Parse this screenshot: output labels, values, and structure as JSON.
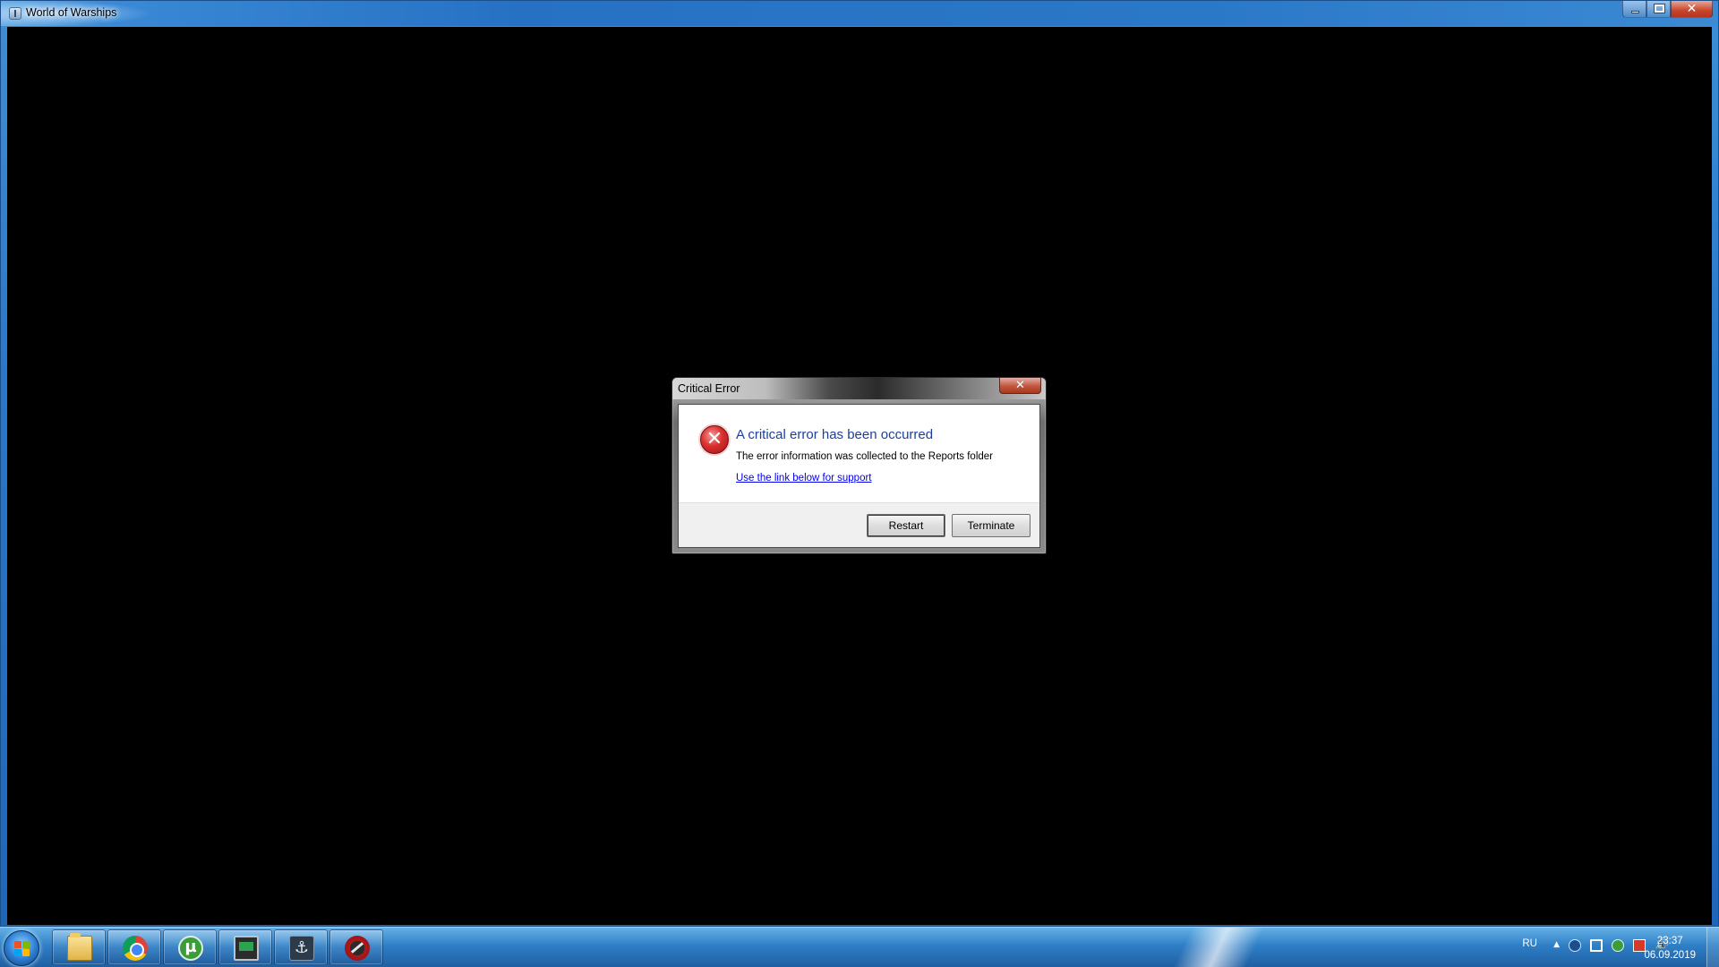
{
  "window": {
    "title": "World of Warships",
    "icon": "warships-app-icon",
    "controls": {
      "minimize": "minimize-icon",
      "maximize": "maximize-icon",
      "close": "✕"
    }
  },
  "dialog": {
    "title": "Critical Error",
    "close_glyph": "✕",
    "icon": "error-icon",
    "icon_glyph": "✕",
    "main_instruction": "A critical error has been occurred",
    "content": "The error information was collected to the Reports folder",
    "link": "Use the link below for support",
    "buttons": {
      "restart": "Restart",
      "terminate": "Terminate"
    }
  },
  "taskbar": {
    "pinned": [
      {
        "name": "Windows Explorer",
        "icon": "folder-icon"
      },
      {
        "name": "Google Chrome",
        "icon": "chrome-icon"
      },
      {
        "name": "uTorrent",
        "icon": "utorrent-icon",
        "glyph": "µ"
      },
      {
        "name": "Monitor",
        "icon": "monitor-icon"
      },
      {
        "name": "World of Warships",
        "icon": "ship-icon",
        "glyph": "⚓"
      },
      {
        "name": "Wargaming Game Center",
        "icon": "wargaming-icon"
      }
    ],
    "tray": {
      "language": "RU",
      "show_hidden": "▲",
      "volume_glyph": "🔊",
      "time": "23:37",
      "date": "06.09.2019"
    }
  },
  "colors": {
    "titlebar_blue": "#2a78c8",
    "dialog_heading": "#1c3f9a",
    "link": "#0000ee",
    "close_red": "#c7452c",
    "client_black": "#000000"
  }
}
